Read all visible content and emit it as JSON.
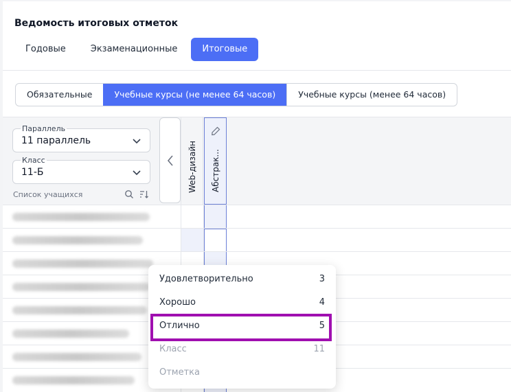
{
  "header": {
    "title": "Ведомость итоговых отметок"
  },
  "top_tabs": [
    {
      "label": "Годовые",
      "active": false
    },
    {
      "label": "Экзаменационные",
      "active": false
    },
    {
      "label": "Итоговые",
      "active": true
    }
  ],
  "course_tabs": [
    {
      "label": "Обязательные",
      "active": false
    },
    {
      "label": "Учебные курсы (не менее 64 часов)",
      "active": true
    },
    {
      "label": "Учебные курсы (менее 64 часов)",
      "active": false
    }
  ],
  "filters": {
    "parallel": {
      "label": "Параллель",
      "value": "11 параллель"
    },
    "class": {
      "label": "Класс",
      "value": "11-Б"
    },
    "students_list_label": "Список учащихся"
  },
  "columns": [
    {
      "label": "Web-дизайн",
      "selected": false
    },
    {
      "label": "Абстрак...",
      "selected": true
    }
  ],
  "dropdown": {
    "options": [
      {
        "label": "Удовлетворительно",
        "value": "3",
        "muted": false
      },
      {
        "label": "Хорошо",
        "value": "4",
        "muted": false
      },
      {
        "label": "Отлично",
        "value": "5",
        "muted": false,
        "highlighted": true
      },
      {
        "label": "Класс",
        "value": "11",
        "muted": true
      },
      {
        "label": "Отметка",
        "value": "",
        "muted": true
      }
    ]
  },
  "icons": {
    "search": "search-icon",
    "sort": "sort-icon",
    "chevron": "chevron-down-icon",
    "prev": "chevron-left-icon",
    "edit": "pencil-icon"
  },
  "colors": {
    "accent": "#4c6ef5",
    "highlight_frame": "#a00fb0"
  }
}
